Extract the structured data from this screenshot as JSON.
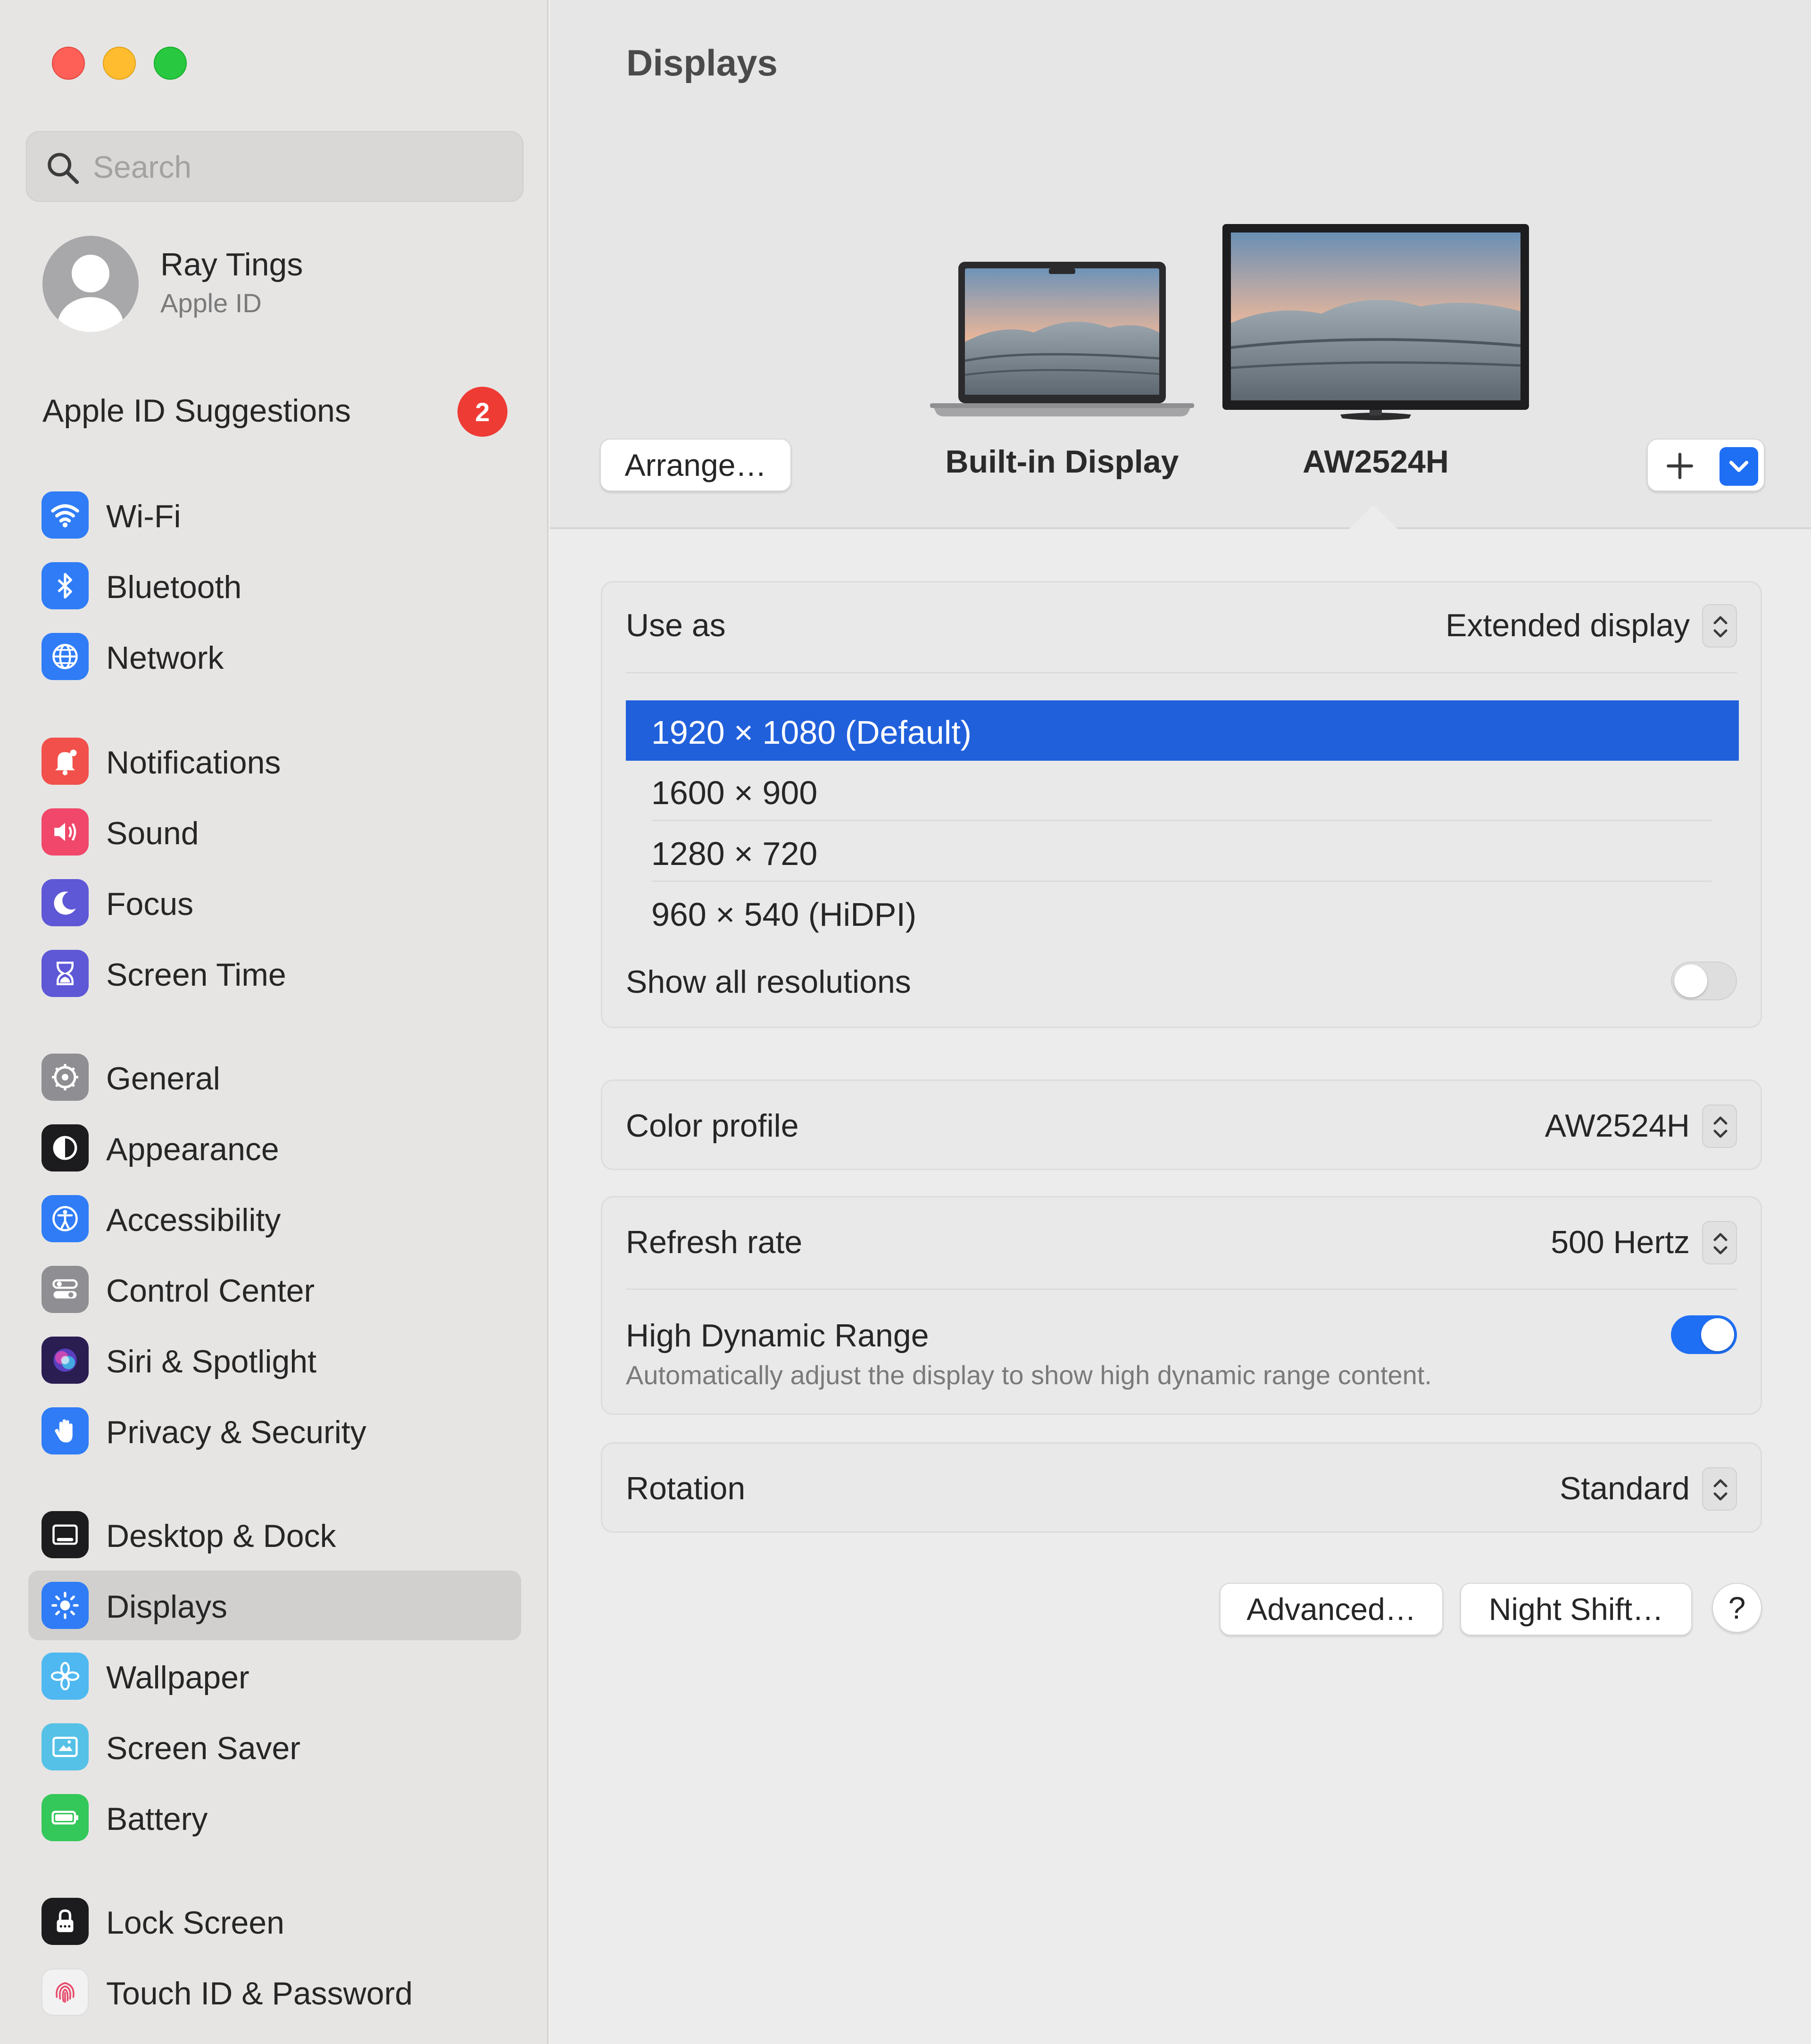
{
  "window": {
    "title": "Displays"
  },
  "sidebar": {
    "search_placeholder": "Search",
    "profile": {
      "name": "Ray Tings",
      "subtitle": "Apple ID"
    },
    "suggestions": {
      "label": "Apple ID Suggestions",
      "count": "2"
    },
    "items": [
      {
        "label": "Wi-Fi",
        "icon": "wifi-icon",
        "color": "#2f7cf6"
      },
      {
        "label": "Bluetooth",
        "icon": "bluetooth-icon",
        "color": "#2f7cf6"
      },
      {
        "label": "Network",
        "icon": "globe-icon",
        "color": "#2f7cf6"
      },
      {
        "label": "Notifications",
        "icon": "bell-icon",
        "color": "#f2504b"
      },
      {
        "label": "Sound",
        "icon": "speaker-icon",
        "color": "#f0476a"
      },
      {
        "label": "Focus",
        "icon": "moon-icon",
        "color": "#5e57d6"
      },
      {
        "label": "Screen Time",
        "icon": "hourglass-icon",
        "color": "#5e57d6"
      },
      {
        "label": "General",
        "icon": "gear-icon",
        "color": "#8e8e93"
      },
      {
        "label": "Appearance",
        "icon": "appearance-icon",
        "color": "#1c1c1e"
      },
      {
        "label": "Accessibility",
        "icon": "accessibility-icon",
        "color": "#2f7cf6"
      },
      {
        "label": "Control Center",
        "icon": "control-center-icon",
        "color": "#8e8e93"
      },
      {
        "label": "Siri & Spotlight",
        "icon": "siri-icon",
        "color": "#3a2a6a"
      },
      {
        "label": "Privacy & Security",
        "icon": "hand-icon",
        "color": "#2f7cf6"
      },
      {
        "label": "Desktop & Dock",
        "icon": "dock-icon",
        "color": "#1c1c1e"
      },
      {
        "label": "Displays",
        "icon": "sun-icon",
        "color": "#2f7cf6",
        "selected": true
      },
      {
        "label": "Wallpaper",
        "icon": "flower-icon",
        "color": "#4fb8f0"
      },
      {
        "label": "Screen Saver",
        "icon": "screen-saver-icon",
        "color": "#56c1e6"
      },
      {
        "label": "Battery",
        "icon": "battery-icon",
        "color": "#34c759"
      },
      {
        "label": "Lock Screen",
        "icon": "lock-icon",
        "color": "#1c1c1e"
      },
      {
        "label": "Touch ID & Password",
        "icon": "fingerprint-icon",
        "color": "#f0f0f0"
      }
    ]
  },
  "main": {
    "arrange_button": "Arrange…",
    "displays": [
      {
        "name": "Built-in Display",
        "icon": "laptop-icon"
      },
      {
        "name": "AW2524H",
        "icon": "monitor-icon",
        "selected": true
      }
    ],
    "use_as": {
      "label": "Use as",
      "value": "Extended display"
    },
    "resolutions": [
      {
        "label": "1920 × 1080 (Default)",
        "selected": true
      },
      {
        "label": "1600 × 900"
      },
      {
        "label": "1280 × 720"
      },
      {
        "label": "960 × 540 (HiDPI)"
      }
    ],
    "show_all_resolutions": {
      "label": "Show all resolutions",
      "on": false
    },
    "color_profile": {
      "label": "Color profile",
      "value": "AW2524H"
    },
    "refresh_rate": {
      "label": "Refresh rate",
      "value": "500 Hertz"
    },
    "hdr": {
      "label": "High Dynamic Range",
      "description": "Automatically adjust the display to show high dynamic range content.",
      "on": true
    },
    "rotation": {
      "label": "Rotation",
      "value": "Standard"
    },
    "buttons": {
      "advanced": "Advanced…",
      "night_shift": "Night Shift…",
      "help": "?"
    },
    "accent_color": "#2160db"
  }
}
